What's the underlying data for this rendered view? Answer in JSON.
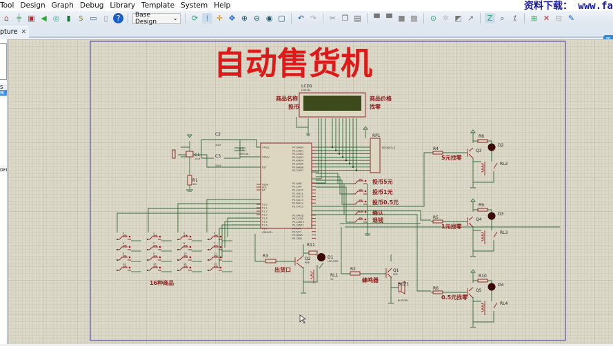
{
  "menu": [
    "Tool",
    "Design",
    "Graph",
    "Debug",
    "Library",
    "Template",
    "System",
    "Help"
  ],
  "watermark": "资料下载： www.fa",
  "toolbar": {
    "design_select": "Base Design",
    "icons": [
      "home-icon",
      "component-icon",
      "chip-icon",
      "audio-icon",
      "zoom-search-icon",
      "book-icon",
      "bom-icon",
      "netlist-icon",
      "document-icon",
      "help-icon",
      "refresh-icon",
      "grid-icon",
      "origin-icon",
      "pan-icon",
      "zoom-in-icon",
      "zoom-out-icon",
      "zoom-all-icon",
      "zoom-area-icon",
      "undo-icon",
      "redo-icon",
      "cut-icon",
      "copy-icon",
      "paste-icon",
      "block-copy-icon",
      "block-move-icon",
      "block-rotate-icon",
      "block-delete-icon",
      "pick-device-icon",
      "make-device-icon",
      "package-icon",
      "decompose-icon",
      "wire-autoroute-icon",
      "search-icon",
      "property-icon",
      "new-sheet-icon",
      "delete-sheet-icon",
      "hierarchy-icon",
      "notes-icon"
    ]
  },
  "tab": {
    "label": "pture",
    "close": "✕"
  },
  "side": {
    "item1": "S",
    "item2": "Bl",
    "item3": "DEI"
  },
  "schematic": {
    "title": "自动售货机",
    "lcd": {
      "ref": "LCD1",
      "part": "LM016L",
      "label_tl": "商品名称",
      "label_bl": "投币",
      "label_tr": "商品价格",
      "label_br": "找零"
    },
    "mcu": {
      "ref": "U1",
      "part": "AT89C51",
      "pins_left": [
        "XTAL1",
        "XTAL2",
        "RST",
        "PSEN",
        "ALE",
        "EA",
        "P1.0",
        "P1.1",
        "P1.2",
        "P1.3",
        "P1.4",
        "P1.5",
        "P1.6",
        "P1.7"
      ],
      "pins_right": [
        "P0.0/AD0",
        "P0.1/AD1",
        "P0.2/AD2",
        "P0.3/AD3",
        "P0.4/AD4",
        "P0.5/AD5",
        "P0.6/AD6",
        "P0.7/AD7",
        "P2.0/A8",
        "P2.1/A9",
        "P2.2/A10",
        "P2.3/A11",
        "P2.4/A12",
        "P2.5/A13",
        "P2.6/A14",
        "P2.7/A15",
        "P3.0/RXD",
        "P3.1/TXD",
        "P3.2/INT0",
        "P3.3/INT1",
        "P3.4/T0",
        "P3.5/T1",
        "P3.6/WR",
        "P3.7/RD"
      ]
    },
    "rp": {
      "ref": "RP1",
      "part": "RESPACK-8"
    },
    "osc": {
      "c1": "C1",
      "c1v": "10uF",
      "c2": "C2",
      "c2v": "30pF",
      "c3": "C3",
      "c3v": "30pF",
      "x1": "X1",
      "x1v": "CRYSTAL",
      "r1": "R1",
      "r1v": "10k"
    },
    "coin_buttons": [
      "投币5元",
      "投币1元",
      "投币0.5元",
      "确认",
      "退钱"
    ],
    "keypad": {
      "labels": [
        "0",
        "1",
        "2",
        "3",
        "4",
        "5",
        "6",
        "7",
        "8",
        "9",
        "10",
        "11",
        "12",
        "13",
        "14",
        "15"
      ],
      "caption": "16种商品"
    },
    "outlet": {
      "r": "R3",
      "rv": "1k",
      "q": "Q2",
      "qv": "PNP",
      "r11": "R11",
      "r11v": "100",
      "d": "D1",
      "dv": "LED-RED",
      "rl": "RL1",
      "rlv": "5V",
      "label": "出货口"
    },
    "buzzer": {
      "r": "R2",
      "rv": "1k",
      "q": "Q1",
      "qv": "PNP",
      "buz": "BUZ1",
      "buzv": "BUZZER",
      "label": "蜂鸣器"
    },
    "change": [
      {
        "r": "R4",
        "q": "Q3",
        "rr": "R8",
        "d": "D2",
        "rl": "RL2",
        "label": "5元找零"
      },
      {
        "r": "R5",
        "q": "Q4",
        "rr": "R9",
        "d": "D3",
        "rl": "RL3",
        "label": "1元找零"
      },
      {
        "r": "R6",
        "q": "Q5",
        "rr": "R10",
        "d": "D4",
        "rl": "RL4",
        "label": "0.5元找零"
      }
    ],
    "colors": {
      "title": "#e01818",
      "label": "#8b1a1a",
      "wire": "#2e6b3a",
      "sheet_border": "#5a4fb0",
      "canvas": "#ddd9c9"
    }
  }
}
